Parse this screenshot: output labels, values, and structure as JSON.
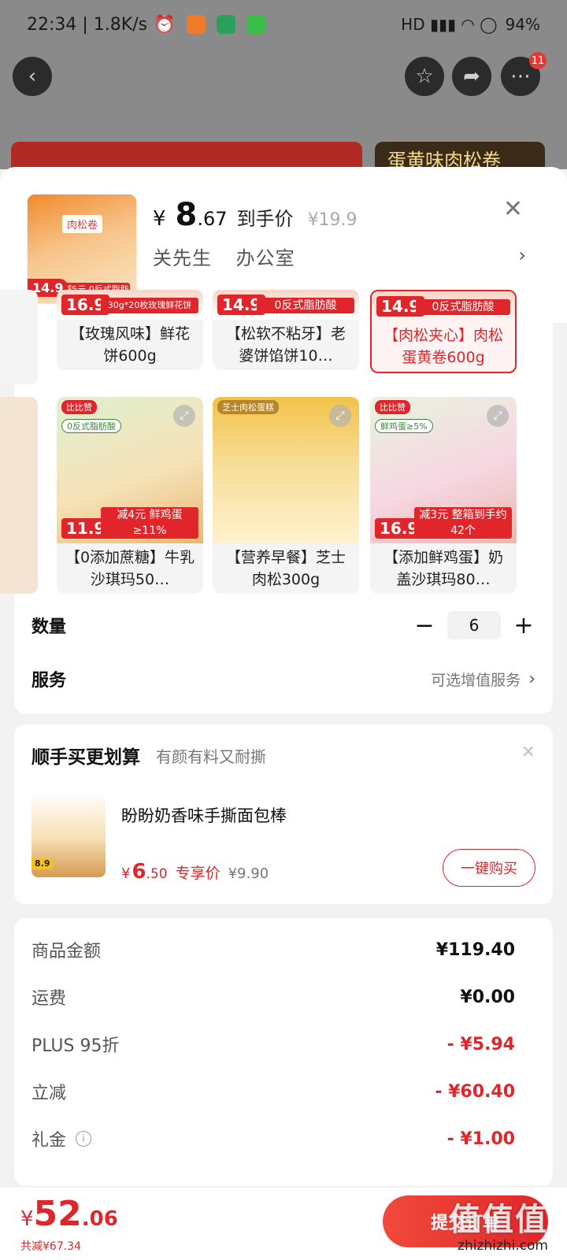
{
  "status_bar": {
    "time_speed": "22:34 | 1.8K/s",
    "battery": "94%",
    "right_icons": "HD ▮▮▮ ◠ ◯"
  },
  "nav": {
    "back_icon": "back-icon",
    "badge_count": "11"
  },
  "banner": {
    "right_text": "蛋黄味肉松卷"
  },
  "sheet": {
    "price_currency": "¥",
    "price_main": "8",
    "price_cents": ".67",
    "price_label": "到手价",
    "original_price": "¥19.9",
    "address_name": "关先生",
    "address_place": "办公室",
    "thumb_tag": "肉松卷",
    "thumb_price": "14.9",
    "thumb_strip": "减5元 0反式脂肪酸"
  },
  "products": [
    {
      "name": "【玫瑰风味】鲜花饼600g",
      "price_tag": "16.9",
      "strip": "30g*20枚玫瑰鲜花饼",
      "selected": false
    },
    {
      "name": "【松软不粘牙】老婆饼馅饼10…",
      "price_tag": "14.9",
      "strip": "0反式脂肪酸",
      "selected": false
    },
    {
      "name": "【肉松夹心】肉松蛋黄卷600g",
      "price_tag": "14.9",
      "strip": "0反式脂肪酸",
      "selected": true
    },
    {
      "name": "【0添加蔗糖】牛乳沙琪玛50…",
      "price_tag": "11.9",
      "strip": "减4元 鲜鸡蛋≥11%",
      "band": "0反式脂肪酸",
      "brand": "比比赞",
      "selected": false
    },
    {
      "name": "【营养早餐】芝士肉松300g",
      "price_tag": "",
      "strip": "",
      "band": "",
      "brand": "芝士肉松蛋糕",
      "selected": false
    },
    {
      "name": "【添加鲜鸡蛋】奶盖沙琪玛80…",
      "price_tag": "16.9",
      "strip": "减3元 整箱到手约42个",
      "band": "鲜鸡蛋≥5%",
      "brand": "比比赞",
      "selected": false
    }
  ],
  "quantity": {
    "label": "数量",
    "minus": "−",
    "value": "6",
    "plus": "+"
  },
  "service": {
    "label": "服务",
    "value": "可选增值服务",
    "chevron": "›"
  },
  "upsell": {
    "title": "顺手买更划算",
    "subtitle": "有颜有料又耐撕",
    "close": "×",
    "product_name": "盼盼奶香味手撕面包棒",
    "thumb_price": "8.9",
    "price_currency": "¥",
    "price_main": "6",
    "price_cents": ".50",
    "price_label": "专享价",
    "original_price": "¥9.90",
    "buy_label": "一键购买"
  },
  "summary": [
    {
      "label": "商品金额",
      "value": "¥119.40",
      "negative": false
    },
    {
      "label": "运费",
      "value": "¥0.00",
      "negative": false
    },
    {
      "label": "PLUS 95折",
      "value": "- ¥5.94",
      "negative": true
    },
    {
      "label": "立减",
      "value": "- ¥60.40",
      "negative": true
    },
    {
      "label": "礼金",
      "value": "- ¥1.00",
      "negative": true
    }
  ],
  "bottom": {
    "total_currency": "¥",
    "total_main": "52",
    "total_cents": ".06",
    "total_saved": "共减¥67.34",
    "submit_label": "提交订单",
    "watermark": "值值值",
    "watermark_url": "zhizhizhi.com"
  },
  "colors": {
    "accent": "#e0262a",
    "background": "#f2f2f2"
  }
}
